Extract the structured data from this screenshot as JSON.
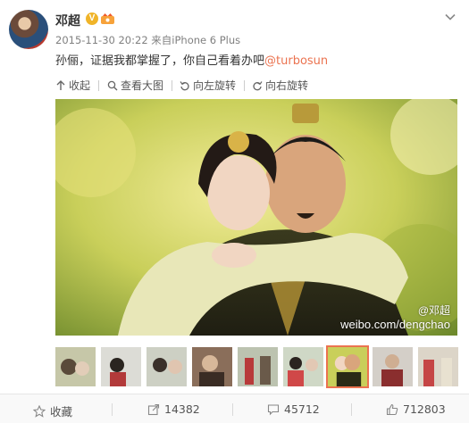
{
  "post": {
    "username": "邓超",
    "verified_badge": "V",
    "timestamp": "2015-11-30 20:22",
    "source_prefix": "来自",
    "source_device": "iPhone 6 Plus",
    "text": "孙俪，证据我都掌握了，你自己看着办吧",
    "mention": "@turbosun"
  },
  "image_actions": {
    "collect": "收起",
    "view_large": "查看大图",
    "rotate_left": "向左旋转",
    "rotate_right": "向右旋转"
  },
  "watermark": {
    "user": "@邓超",
    "url": "weibo.com/dengchao"
  },
  "thumbnails": {
    "count": 9,
    "active_index": 6
  },
  "footer": {
    "favorite": "收藏",
    "repost_count": "14382",
    "comment_count": "45712",
    "like_count": "712803"
  },
  "colors": {
    "accent": "#eb7350",
    "verified": "#f0b429",
    "meta_text": "#808080"
  },
  "icons": [
    "chevron-down-icon",
    "collapse-arrow-icon",
    "magnifier-icon",
    "rotate-left-icon",
    "rotate-right-icon",
    "star-icon",
    "repost-icon",
    "comment-icon",
    "thumbs-up-icon"
  ]
}
